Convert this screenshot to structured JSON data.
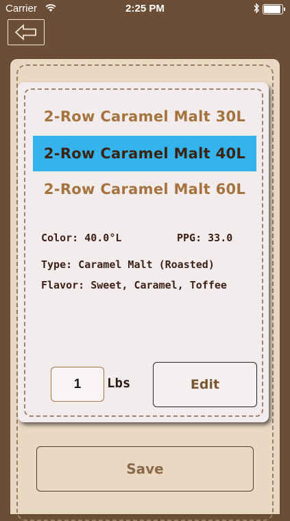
{
  "status_bar": {
    "carrier": "Carrier",
    "time": "2:25 PM",
    "battery_level": 1.0
  },
  "nav": {
    "back_icon": "back-arrow-icon"
  },
  "modal": {
    "picker_items": [
      {
        "label": "2-Row Caramel Malt 30L",
        "selected": false
      },
      {
        "label": "2-Row Caramel Malt 40L",
        "selected": true
      },
      {
        "label": "2-Row Caramel Malt 60L",
        "selected": false
      }
    ],
    "selection_color": "#34b3ec",
    "color_text": "Color: 40.0°L",
    "ppg_text": "PPG: 33.0",
    "type_text": "Type: Caramel Malt (Roasted)",
    "flavor_text": "Flavor: Sweet, Caramel, Toffee",
    "quantity_value": "1",
    "unit_label": "Lbs",
    "edit_label": "Edit"
  },
  "footer": {
    "save_label": "Save"
  },
  "colors": {
    "background_brown": "#6b4e35",
    "panel_tan": "#e9d9c3",
    "card_white": "#f2edec"
  }
}
